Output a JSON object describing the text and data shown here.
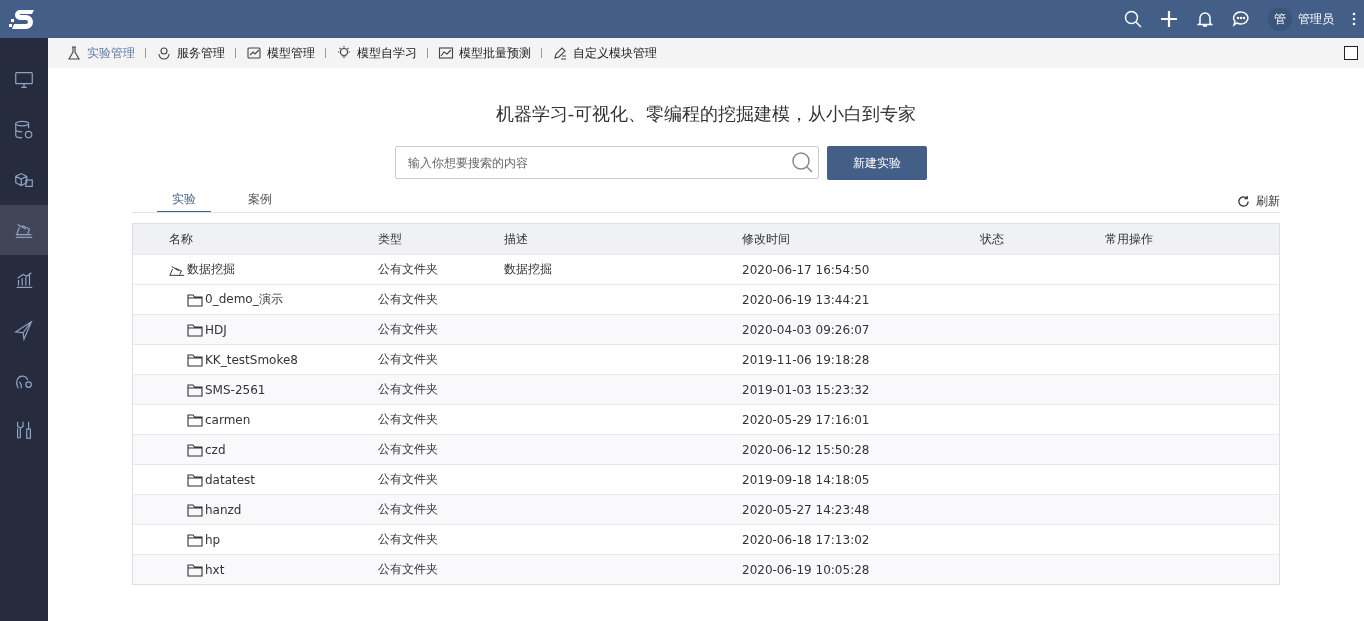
{
  "topbar": {
    "avatar": "管",
    "user": "管理员"
  },
  "sidebar": {
    "items": [
      {
        "selected": false
      },
      {
        "selected": false
      },
      {
        "selected": false
      },
      {
        "selected": true
      },
      {
        "selected": false
      },
      {
        "selected": false
      },
      {
        "selected": false
      },
      {
        "selected": false
      }
    ]
  },
  "toolbar": {
    "items": [
      {
        "label": "实验管理",
        "selected": true
      },
      {
        "label": "服务管理",
        "selected": false
      },
      {
        "label": "模型管理",
        "selected": false
      },
      {
        "label": "模型自学习",
        "selected": false
      },
      {
        "label": "模型批量预测",
        "selected": false
      },
      {
        "label": "自定义模块管理",
        "selected": false
      }
    ]
  },
  "heading": "机器学习-可视化、零编程的挖掘建模，从小白到专家",
  "search": {
    "placeholder": "输入你想要搜索的内容"
  },
  "new_button": "新建实验",
  "tabs": [
    {
      "label": "实验",
      "selected": true
    },
    {
      "label": "案例",
      "selected": false
    }
  ],
  "refresh": "刷新",
  "table": {
    "columns": [
      "名称",
      "类型",
      "描述",
      "修改时间",
      "状态",
      "常用操作"
    ],
    "rows": [
      {
        "name": "数据挖掘",
        "type": "公有文件夹",
        "description": "数据挖掘",
        "modified": "2020-06-17 16:54:50",
        "children": [
          {
            "name": "0_demo_演示",
            "type": "公有文件夹",
            "modified": "2020-06-19 13:44:21"
          },
          {
            "name": "HDJ",
            "type": "公有文件夹",
            "modified": "2020-04-03 09:26:07"
          },
          {
            "name": "KK_testSmoke8",
            "type": "公有文件夹",
            "modified": "2019-11-06 19:18:28"
          },
          {
            "name": "SMS-2561",
            "type": "公有文件夹",
            "modified": "2019-01-03 15:23:32"
          },
          {
            "name": "carmen",
            "type": "公有文件夹",
            "modified": "2020-05-29 17:16:01"
          },
          {
            "name": "czd",
            "type": "公有文件夹",
            "modified": "2020-06-12 15:50:28"
          },
          {
            "name": "datatest",
            "type": "公有文件夹",
            "modified": "2019-09-18 14:18:05"
          },
          {
            "name": "hanzd",
            "type": "公有文件夹",
            "modified": "2020-05-27 14:23:48"
          },
          {
            "name": "hp",
            "type": "公有文件夹",
            "modified": "2020-06-18 17:13:02"
          },
          {
            "name": "hxt",
            "type": "公有文件夹",
            "modified": "2020-06-19 10:05:28"
          }
        ]
      }
    ]
  }
}
